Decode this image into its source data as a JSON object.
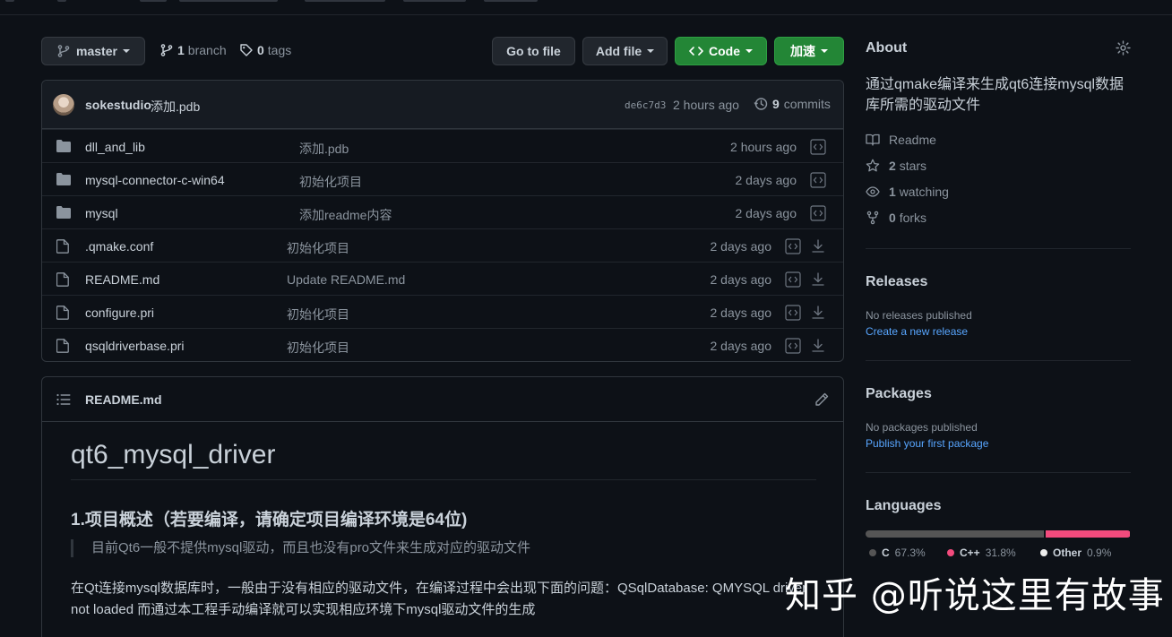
{
  "toolbar": {
    "branch": "master",
    "branch_count": "1",
    "branch_word": "branch",
    "tag_count": "0",
    "tag_word": "tags",
    "go_to_file": "Go to file",
    "add_file": "Add file",
    "code": "Code",
    "speedup": "加速"
  },
  "commit": {
    "user": "sokestudio",
    "message": "添加.pdb",
    "sha": "de6c7d3",
    "time": "2 hours ago",
    "count": "9",
    "count_word": "commits"
  },
  "files": [
    {
      "type": "dir",
      "name": "dll_and_lib",
      "message": "添加.pdb",
      "age": "2 hours ago"
    },
    {
      "type": "dir",
      "name": "mysql-connector-c-win64",
      "message": "初始化项目",
      "age": "2 days ago"
    },
    {
      "type": "dir",
      "name": "mysql",
      "message": "添加readme内容",
      "age": "2 days ago"
    },
    {
      "type": "file",
      "name": ".qmake.conf",
      "message": "初始化项目",
      "age": "2 days ago"
    },
    {
      "type": "file",
      "name": "README.md",
      "message": "Update README.md",
      "age": "2 days ago"
    },
    {
      "type": "file",
      "name": "configure.pri",
      "message": "初始化项目",
      "age": "2 days ago"
    },
    {
      "type": "file",
      "name": "qsqldriverbase.pri",
      "message": "初始化项目",
      "age": "2 days ago"
    }
  ],
  "readme": {
    "filename": "README.md",
    "h1": "qt6_mysql_driver",
    "h2": "1.项目概述（若要编译，请确定项目编译环境是64位)",
    "quote": "目前Qt6一般不提供mysql驱动，而且也没有pro文件来生成对应的驱动文件",
    "para": "在Qt连接mysql数据库时，一般由于没有相应的驱动文件，在编译过程中会出现下面的问题：QSqlDatabase: QMYSQL driver not loaded 而通过本工程手动编译就可以实现相应环境下mysql驱动文件的生成"
  },
  "about": {
    "title": "About",
    "description": "通过qmake编译来生成qt6连接mysql数据库所需的驱动文件",
    "readme": "Readme",
    "stars_count": "2",
    "stars_word": "stars",
    "watching_count": "1",
    "watching_word": "watching",
    "forks_count": "0",
    "forks_word": "forks"
  },
  "releases": {
    "title": "Releases",
    "none": "No releases published",
    "link": "Create a new release"
  },
  "packages": {
    "title": "Packages",
    "none": "No packages published",
    "link": "Publish your first package"
  },
  "languages": {
    "title": "Languages",
    "items": [
      {
        "name": "C",
        "percent": "67.3%",
        "color": "#555555",
        "value": 67.3
      },
      {
        "name": "C++",
        "percent": "31.8%",
        "color": "#f34b7d",
        "value": 31.8
      },
      {
        "name": "Other",
        "percent": "0.9%",
        "color": "#ededed",
        "value": 0.9
      }
    ]
  },
  "watermark": "知乎 @听说这里有故事"
}
